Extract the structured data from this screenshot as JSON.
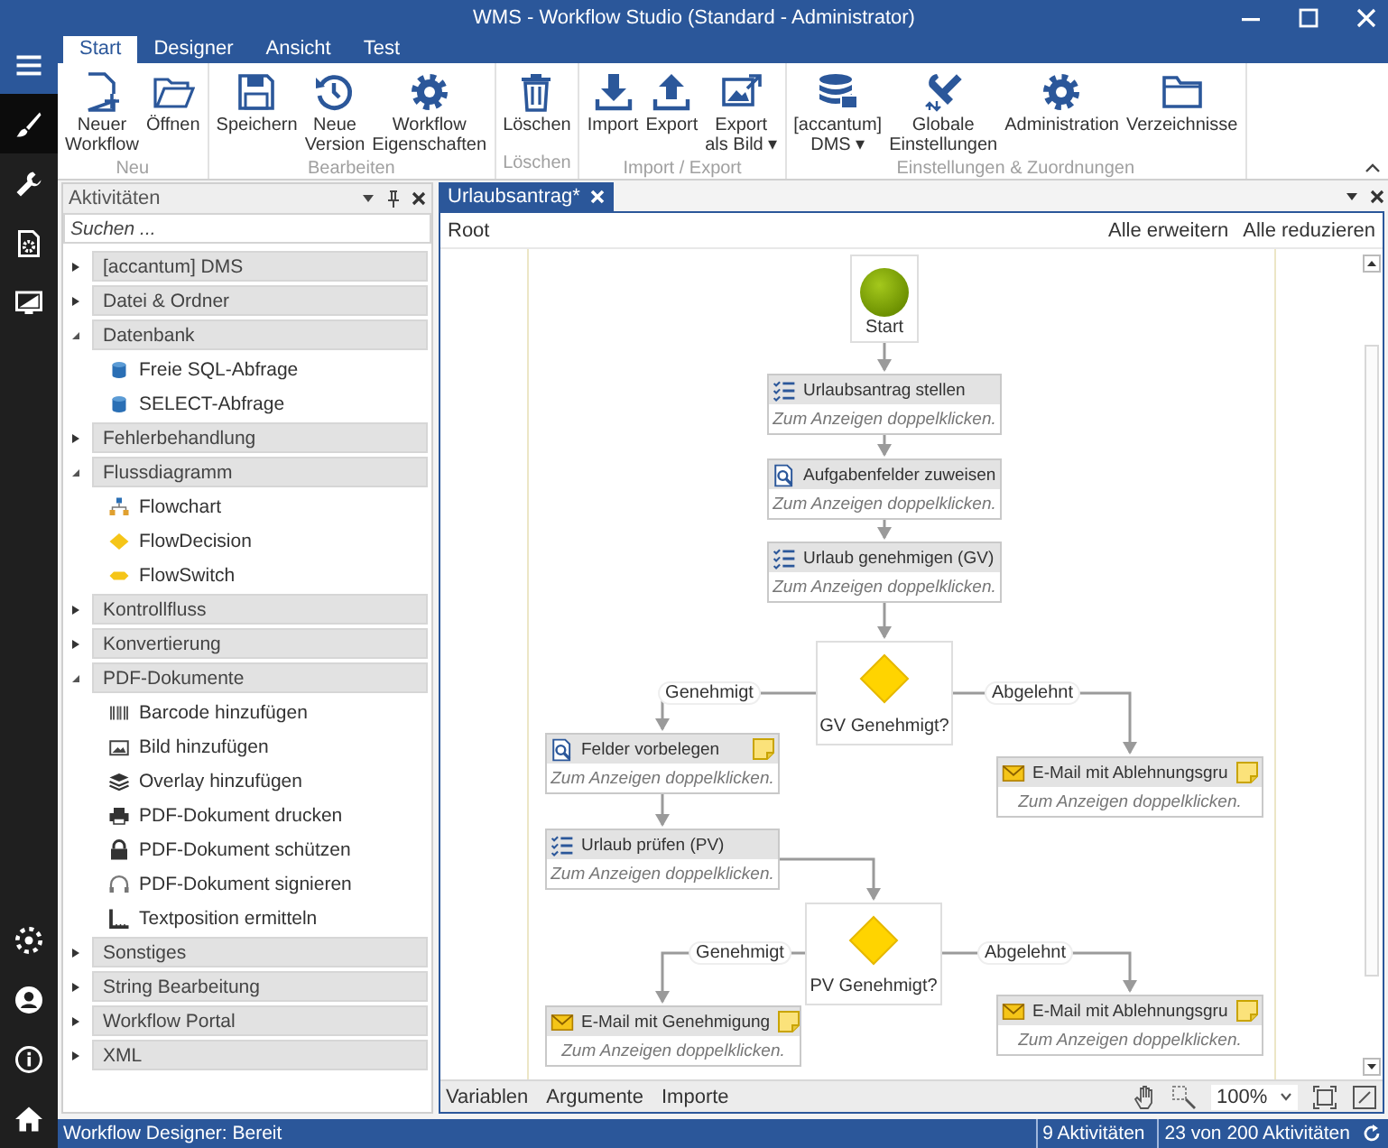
{
  "window": {
    "title": "WMS - Workflow Studio (Standard - Administrator)"
  },
  "rail": {
    "top": [
      {
        "kind": "menu",
        "selected": false
      },
      {
        "kind": "designer",
        "selected": true
      },
      {
        "kind": "tools",
        "selected": false
      },
      {
        "kind": "deploy",
        "selected": false
      },
      {
        "kind": "monitor",
        "selected": false
      }
    ],
    "bottom": [
      {
        "kind": "settings",
        "selected": false
      },
      {
        "kind": "user",
        "selected": false
      },
      {
        "kind": "info",
        "selected": false
      },
      {
        "kind": "home",
        "selected": false
      }
    ]
  },
  "ribbon": {
    "tabs": [
      {
        "label": "Start",
        "selected": true
      },
      {
        "label": "Designer",
        "selected": false
      },
      {
        "label": "Ansicht",
        "selected": false
      },
      {
        "label": "Test",
        "selected": false
      }
    ],
    "groups": [
      {
        "label": "Neu",
        "buttons": [
          {
            "kind": "new",
            "lines": [
              "Neuer",
              "Workflow"
            ]
          },
          {
            "kind": "open",
            "lines": [
              "Öffnen"
            ]
          }
        ]
      },
      {
        "label": "Bearbeiten",
        "buttons": [
          {
            "kind": "save",
            "lines": [
              "Speichern"
            ]
          },
          {
            "kind": "version",
            "lines": [
              "Neue",
              "Version"
            ]
          },
          {
            "kind": "properties",
            "lines": [
              "Workflow",
              "Eigenschaften"
            ]
          }
        ]
      },
      {
        "label": "Löschen",
        "buttons": [
          {
            "kind": "delete",
            "lines": [
              "Löschen"
            ]
          }
        ]
      },
      {
        "label": "Import / Export",
        "buttons": [
          {
            "kind": "import",
            "lines": [
              "Import"
            ]
          },
          {
            "kind": "export",
            "lines": [
              "Export"
            ]
          },
          {
            "kind": "image",
            "lines": [
              "Export",
              "als Bild ▾"
            ]
          }
        ]
      },
      {
        "label": "Einstellungen & Zuordnungen",
        "buttons": [
          {
            "kind": "dms",
            "lines": [
              "[accantum]",
              "DMS ▾"
            ]
          },
          {
            "kind": "global",
            "lines": [
              "Globale",
              "Einstellungen"
            ]
          },
          {
            "kind": "admin",
            "lines": [
              "Administration"
            ]
          },
          {
            "kind": "folders",
            "lines": [
              "Verzeichnisse"
            ]
          }
        ]
      }
    ]
  },
  "activities": {
    "title": "Aktivitäten",
    "search": {
      "placeholder": "Suchen ..."
    },
    "categories": [
      {
        "label": "[accantum] DMS",
        "expanded": false
      },
      {
        "label": "Datei & Ordner",
        "expanded": false
      },
      {
        "label": "Datenbank",
        "expanded": true,
        "children": [
          {
            "label": "Freie SQL-Abfrage",
            "kind": "database"
          },
          {
            "label": "SELECT-Abfrage",
            "kind": "database"
          }
        ]
      },
      {
        "label": "Fehlerbehandlung",
        "expanded": false
      },
      {
        "label": "Flussdiagramm",
        "expanded": true,
        "children": [
          {
            "label": "Flowchart",
            "kind": "flowchart"
          },
          {
            "label": "FlowDecision",
            "kind": "decision"
          },
          {
            "label": "FlowSwitch",
            "kind": "switch"
          }
        ]
      },
      {
        "label": "Kontrollfluss",
        "expanded": false
      },
      {
        "label": "Konvertierung",
        "expanded": false
      },
      {
        "label": "PDF-Dokumente",
        "expanded": true,
        "children": [
          {
            "label": "Barcode hinzufügen",
            "kind": "barcode"
          },
          {
            "label": "Bild hinzufügen",
            "kind": "image"
          },
          {
            "label": "Overlay hinzufügen",
            "kind": "overlay"
          },
          {
            "label": "PDF-Dokument drucken",
            "kind": "print"
          },
          {
            "label": "PDF-Dokument schützen",
            "kind": "lock"
          },
          {
            "label": "PDF-Dokument signieren",
            "kind": "sign"
          },
          {
            "label": "Textposition ermitteln",
            "kind": "position"
          }
        ]
      },
      {
        "label": "Sonstiges",
        "expanded": false
      },
      {
        "label": "String Bearbeitung",
        "expanded": false
      },
      {
        "label": "Workflow Portal",
        "expanded": false
      },
      {
        "label": "XML",
        "expanded": false
      }
    ]
  },
  "document": {
    "tabs": [
      {
        "label": "Urlaubsantrag*",
        "selected": true
      }
    ],
    "breadcrumb": "Root",
    "actions": [
      "Alle erweitern",
      "Alle reduzieren"
    ],
    "nodes": [
      {
        "kind": "start",
        "label": "Start"
      },
      {
        "kind": "task",
        "title": "Urlaubsantrag stellen",
        "hint": "Zum Anzeigen doppelklicken.",
        "note": false
      },
      {
        "kind": "form",
        "title": "Aufgabenfelder zuweisen",
        "hint": "Zum Anzeigen doppelklicken.",
        "note": false
      },
      {
        "kind": "task",
        "title": "Urlaub genehmigen (GV)",
        "hint": "Zum Anzeigen doppelklicken.",
        "note": false
      },
      {
        "kind": "decision",
        "label": "GV Genehmigt?",
        "branches": [
          "Genehmigt",
          "Abgelehnt"
        ]
      },
      {
        "kind": "form",
        "title": "Felder vorbelegen",
        "hint": "Zum Anzeigen doppelklicken.",
        "note": true
      },
      {
        "kind": "mail",
        "title": "E-Mail mit Ablehnungsgru",
        "hint": "Zum Anzeigen doppelklicken.",
        "note": true
      },
      {
        "kind": "task",
        "title": "Urlaub prüfen (PV)",
        "hint": "Zum Anzeigen doppelklicken.",
        "note": false
      },
      {
        "kind": "decision",
        "label": "PV Genehmigt?",
        "branches": [
          "Genehmigt",
          "Abgelehnt"
        ]
      },
      {
        "kind": "mail",
        "title": "E-Mail mit Genehmigung",
        "hint": "Zum Anzeigen doppelklicken.",
        "note": true
      },
      {
        "kind": "mail",
        "title": "E-Mail mit Ablehnungsgru",
        "hint": "Zum Anzeigen doppelklicken.",
        "note": true
      }
    ],
    "bottom_tabs": [
      "Variablen",
      "Argumente",
      "Importe"
    ],
    "zoom": {
      "value": "100%"
    }
  },
  "status_bar": {
    "message": "Workflow Designer: Bereit",
    "counts": [
      "9 Aktivitäten",
      "23 von 200 Aktivitäten"
    ]
  }
}
